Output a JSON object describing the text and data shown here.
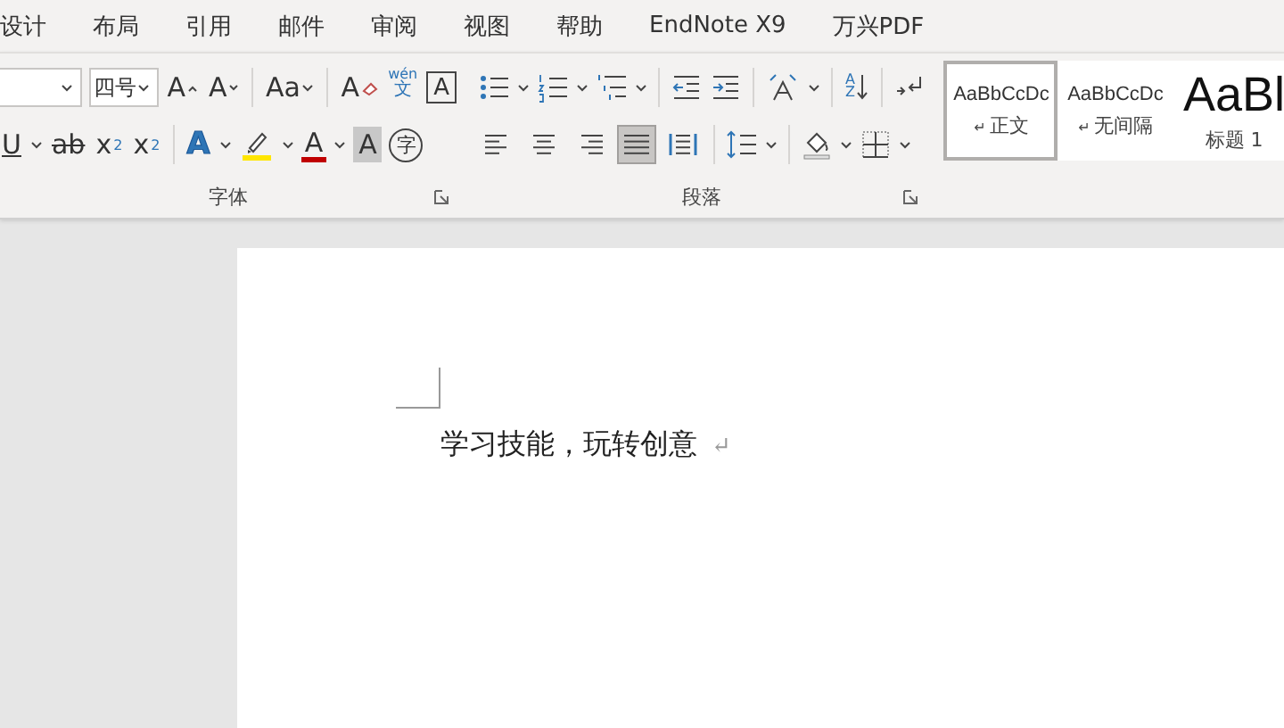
{
  "tabs": [
    {
      "label": "设计"
    },
    {
      "label": "布局"
    },
    {
      "label": "引用"
    },
    {
      "label": "邮件"
    },
    {
      "label": "审阅"
    },
    {
      "label": "视图"
    },
    {
      "label": "帮助"
    },
    {
      "label": "EndNote X9"
    },
    {
      "label": "万兴PDF"
    }
  ],
  "font_group": {
    "label": "字体",
    "font_size": "四号",
    "grow_font": "A",
    "shrink_font": "A",
    "change_case": "Aa",
    "clear_formatting": "A",
    "phonetic_guide": {
      "pinyin": "wén",
      "char": "文"
    },
    "character_border": "A",
    "underline": "U",
    "strikethrough": "ab",
    "subscript": {
      "base": "x",
      "index": "2"
    },
    "superscript": {
      "base": "x",
      "index": "2"
    },
    "text_effects": "A",
    "font_color": "A",
    "character_shading": "A",
    "enclose_characters": "字"
  },
  "paragraph_group": {
    "label": "段落",
    "sort": {
      "top": "A",
      "bottom": "Z"
    },
    "alignment": [
      {
        "kind": "left",
        "selected": false
      },
      {
        "kind": "center",
        "selected": false
      },
      {
        "kind": "right",
        "selected": false
      },
      {
        "kind": "justify",
        "selected": true
      },
      {
        "kind": "distributed",
        "selected": false
      }
    ]
  },
  "styles": [
    {
      "preview": "AaBbCcDc",
      "name": "正文",
      "mark": "↵",
      "kind": "body",
      "selected": true
    },
    {
      "preview": "AaBbCcDc",
      "name": "无间隔",
      "mark": "↵",
      "kind": "body",
      "selected": false
    },
    {
      "preview": "AaBl",
      "name": "标题 1",
      "kind": "heading",
      "selected": false
    }
  ],
  "document": {
    "text": "学习技能，玩转创意",
    "mark": "↵"
  }
}
